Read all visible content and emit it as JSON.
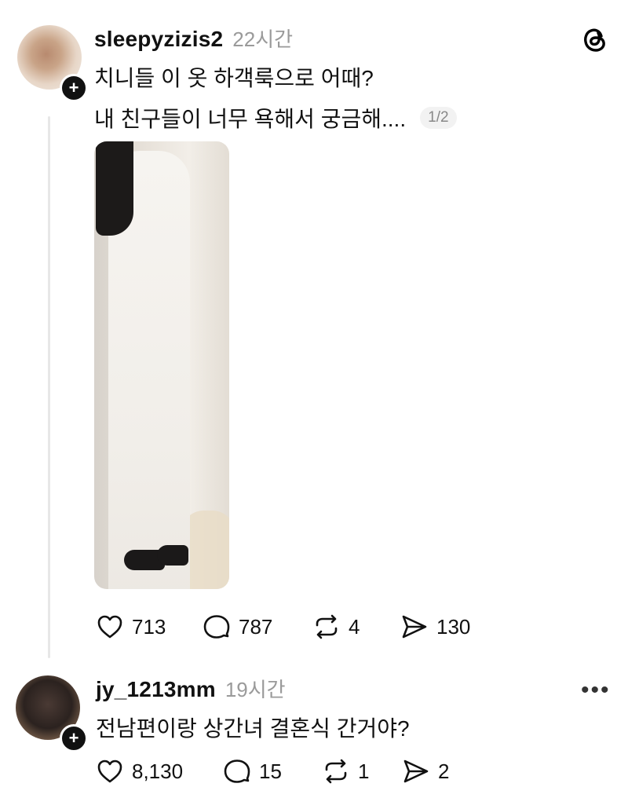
{
  "post": {
    "username": "sleepyzizis2",
    "time": "22시간",
    "line1": "치니들 이 옷 하객룩으로 어때?",
    "line2": "내 친구들이 너무 욕해서 궁금해....",
    "page_indicator": "1/2",
    "likes": "713",
    "comments": "787",
    "reposts": "4",
    "shares": "130"
  },
  "reply": {
    "username": "jy_1213mm",
    "time": "19시간",
    "text": "전남편이랑 상간녀 결혼식 간거야?",
    "likes": "8,130",
    "comments": "15",
    "reposts": "1",
    "shares": "2"
  },
  "icons": {
    "brand": "threads-icon",
    "like": "heart-icon",
    "comment": "comment-icon",
    "repost": "repost-icon",
    "share": "send-icon",
    "more": "more-icon"
  }
}
